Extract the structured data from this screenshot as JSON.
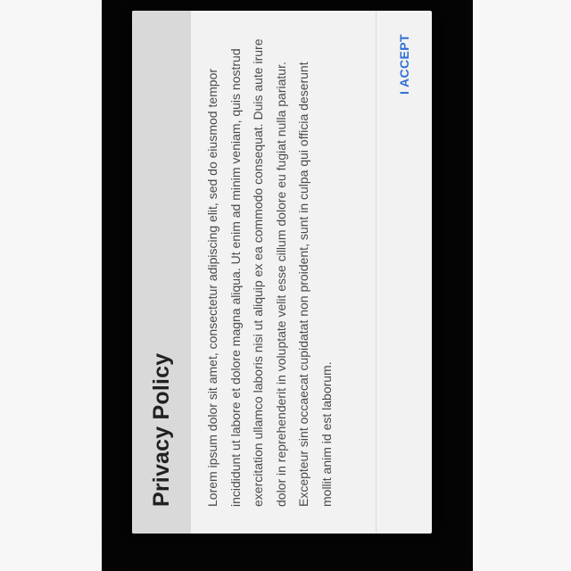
{
  "dialog": {
    "title": "Privacy Policy",
    "body": "Lorem ipsum dolor sit amet, consectetur adipiscing elit, sed do eiusmod tempor incididunt ut labore et dolore magna aliqua. Ut enim ad minim veniam, quis nostrud exercitation ullamco laboris nisi ut aliquip ex ea commodo consequat. Duis aute irure dolor in reprehenderit in voluptate velit esse cillum dolore eu fugiat nulla pariatur. Excepteur sint occaecat cupidatat non proident, sunt in culpa qui officia deserunt mollit anim id est laborum.",
    "accept_label": "I ACCEPT"
  },
  "colors": {
    "accent": "#2f6fd6",
    "header_background": "#d9d9d9",
    "dialog_background": "#f2f2f2",
    "scrim": "#050505"
  }
}
